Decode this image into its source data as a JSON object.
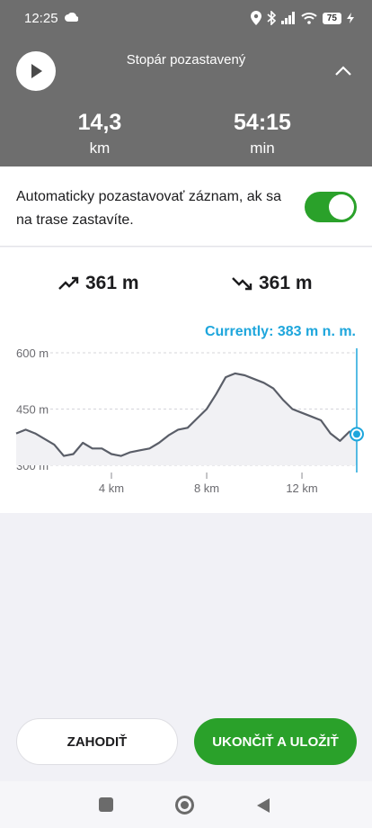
{
  "status_bar": {
    "time": "12:25",
    "battery": "75",
    "icons": [
      "cloud-icon",
      "location-icon",
      "bluetooth-icon",
      "signal-icon",
      "wifi-icon",
      "battery-icon"
    ]
  },
  "header": {
    "title": "Stopár pozastavený",
    "distance_value": "14,3",
    "distance_unit": "km",
    "time_value": "54:15",
    "time_unit": "min",
    "background_color": "#6e6e6e"
  },
  "auto_pause": {
    "label": "Automaticky pozastavovať záznam, ak sa na trase zastavíte.",
    "enabled": true,
    "toggle_color": "#2aa12a"
  },
  "elevation": {
    "ascent": "361 m",
    "descent": "361 m",
    "current_label": "Currently: 383 m n. m.",
    "accent_color": "#1ea6dc"
  },
  "chart_data": {
    "type": "area",
    "y_tick_labels": [
      "600 m",
      "450 m",
      "300 m"
    ],
    "x_tick_labels": [
      "4 km",
      "8 km",
      "12 km"
    ],
    "ylim": [
      300,
      600
    ],
    "xlim": [
      0,
      14.3
    ],
    "grid": true,
    "x": [
      0,
      0.4,
      0.8,
      1.2,
      1.6,
      2.0,
      2.4,
      2.8,
      3.2,
      3.6,
      4.0,
      4.4,
      4.8,
      5.2,
      5.6,
      6.0,
      6.4,
      6.8,
      7.2,
      7.6,
      8.0,
      8.4,
      8.8,
      9.2,
      9.6,
      10.0,
      10.4,
      10.8,
      11.2,
      11.6,
      12.0,
      12.4,
      12.8,
      13.2,
      13.6,
      14.0,
      14.3
    ],
    "y": [
      385,
      395,
      385,
      370,
      355,
      325,
      330,
      360,
      345,
      345,
      330,
      325,
      335,
      340,
      345,
      360,
      380,
      395,
      400,
      425,
      450,
      490,
      535,
      545,
      540,
      530,
      520,
      505,
      475,
      450,
      440,
      430,
      420,
      385,
      365,
      390,
      383
    ],
    "current_value": 383,
    "current_unit": "m n. m."
  },
  "actions": {
    "discard_label": "ZAHODIŤ",
    "save_label": "UKONČIŤ A ULOŽIŤ"
  },
  "nav_bar": {
    "items": [
      "recents-icon",
      "home-icon",
      "back-icon"
    ]
  }
}
